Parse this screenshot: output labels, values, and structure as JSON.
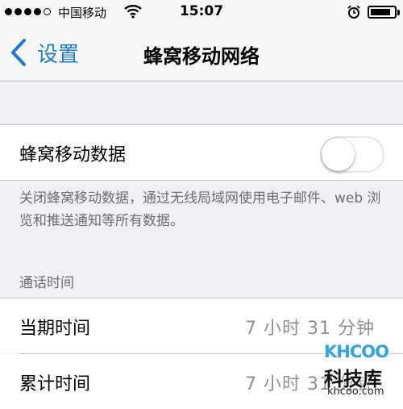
{
  "status_bar": {
    "signal_filled": 4,
    "signal_total": 5,
    "carrier": "中国移动",
    "time": "15:07",
    "wifi_icon": "wifi-icon",
    "alarm_icon": "alarm-clock-icon",
    "battery_level": 0.85
  },
  "nav": {
    "back_label": "设置",
    "title": "蜂窝移动网络",
    "accent_color": "#1a7bd6"
  },
  "cellular_data": {
    "label": "蜂窝移动数据",
    "enabled": false,
    "footer": "关闭蜂窝移动数据，通过无线局域网使用电子邮件、web 浏览和推送通知等所有数据。"
  },
  "call_time": {
    "header": "通话时间",
    "rows": [
      {
        "label": "当期时间",
        "value": "7 小时 31 分钟"
      },
      {
        "label": "累计时间",
        "value": "7 小时 31 分钟"
      }
    ]
  },
  "watermark": {
    "logo": "KHCOO",
    "name": "科技库",
    "url": "khcoo.com"
  }
}
